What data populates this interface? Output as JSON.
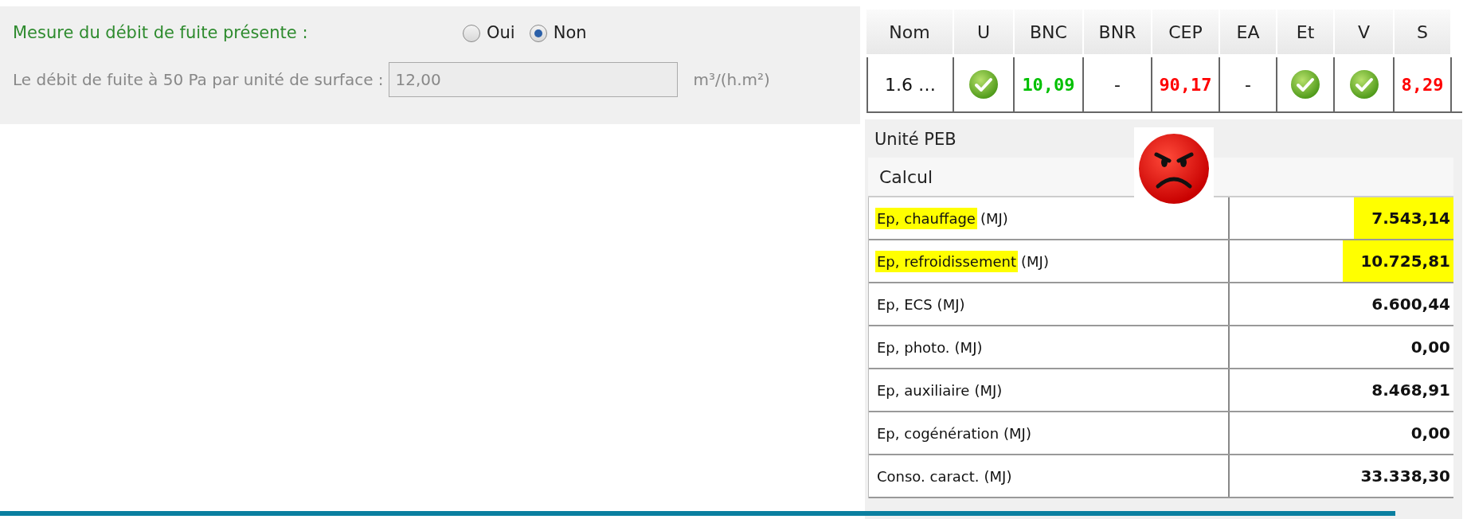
{
  "leak_form": {
    "presence": {
      "label": "Mesure du débit de fuite présente :",
      "options": [
        {
          "label": "Oui",
          "selected": false
        },
        {
          "label": "Non",
          "selected": true
        }
      ]
    },
    "rate": {
      "label": "Le débit de fuite à 50 Pa par unité de surface :",
      "value": "12,00",
      "unit": "m³/(h.m²)",
      "disabled": true
    }
  },
  "summary_table": {
    "columns": [
      "Nom",
      "U",
      "BNC",
      "BNR",
      "CEP",
      "EA",
      "Et",
      "V",
      "S"
    ],
    "row": [
      {
        "kind": "text",
        "text": "1.6 …"
      },
      {
        "kind": "check"
      },
      {
        "kind": "text",
        "text": "10,09",
        "color": "#00c000"
      },
      {
        "kind": "text",
        "text": "-"
      },
      {
        "kind": "text",
        "text": "90,17",
        "color": "#ff0000"
      },
      {
        "kind": "text",
        "text": "-"
      },
      {
        "kind": "check"
      },
      {
        "kind": "check"
      },
      {
        "kind": "text",
        "text": "8,29",
        "color": "#ff0000"
      }
    ]
  },
  "unit_group": {
    "title": "Unité PEB",
    "tab": "Calcul",
    "rows": [
      {
        "label": "Ep, chauffage",
        "unit": "(MJ)",
        "value": "7.543,14",
        "highlighted": true
      },
      {
        "label": "Ep, refroidissement",
        "unit": "(MJ)",
        "value": "10.725,81",
        "highlighted": true
      },
      {
        "label": "Ep, ECS",
        "unit": "(MJ)",
        "value": "6.600,44",
        "highlighted": false
      },
      {
        "label": "Ep, photo.",
        "unit": "(MJ)",
        "value": "0,00",
        "highlighted": false
      },
      {
        "label": "Ep, auxiliaire",
        "unit": "(MJ)",
        "value": "8.468,91",
        "highlighted": false
      },
      {
        "label": "Ep, cogénération",
        "unit": "(MJ)",
        "value": "0,00",
        "highlighted": false
      },
      {
        "label": "Conso. caract.",
        "unit": "(MJ)",
        "value": "33.338,30",
        "highlighted": false
      }
    ]
  }
}
